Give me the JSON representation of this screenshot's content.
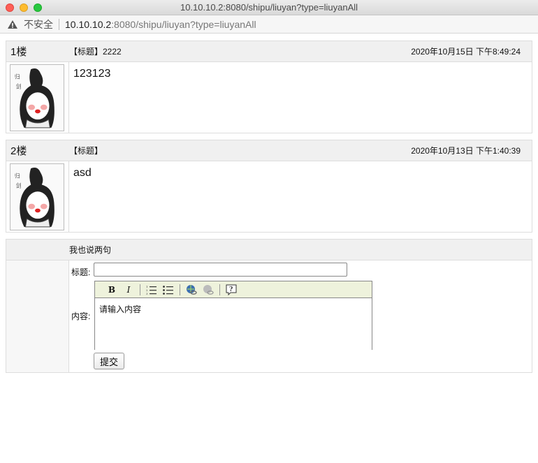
{
  "window": {
    "title": "10.10.10.2:8080/shipu/liuyan?type=liuyanAll"
  },
  "addressbar": {
    "security_label": "不安全",
    "url_host": "10.10.10.2",
    "url_rest": ":8080/shipu/liuyan?type=liuyanAll"
  },
  "posts": [
    {
      "floor": "1楼",
      "title": "【标题】2222",
      "time": "2020年10月15日 下午8:49:24",
      "message": "123123"
    },
    {
      "floor": "2楼",
      "title": "【标题】",
      "time": "2020年10月13日 下午1:40:39",
      "message": "asd"
    }
  ],
  "reply": {
    "heading": "我也说两句",
    "title_label": "标题:",
    "title_value": "",
    "content_label": "内容:",
    "content_text": "请输入内容",
    "submit_label": "提交"
  },
  "colors": {
    "toolbar_bg": "#eef2dc",
    "header_bg": "#f0f0f0"
  }
}
